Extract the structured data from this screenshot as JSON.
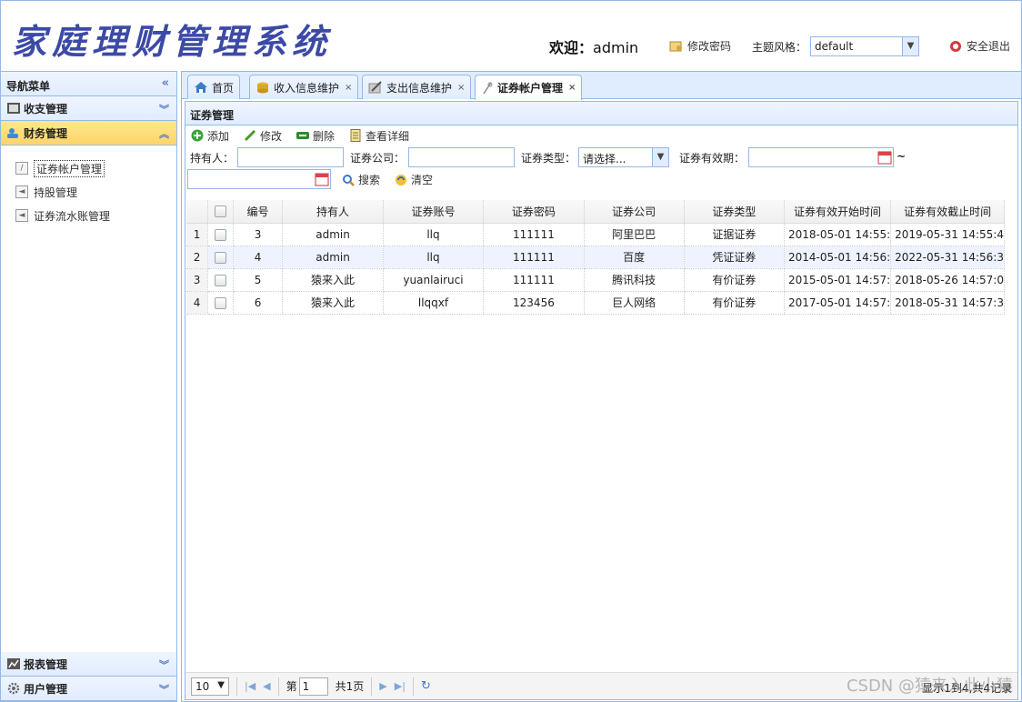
{
  "header": {
    "logo": "家庭理财管理系统",
    "welcome_prefix": "欢迎：",
    "username": "admin",
    "change_password": "修改密码",
    "theme_label": "主题风格：",
    "theme_value": "default",
    "logout": "安全退出"
  },
  "sidebar": {
    "title": "导航菜单",
    "groups": [
      {
        "label": "收支管理"
      },
      {
        "label": "财务管理"
      },
      {
        "label": "报表管理"
      },
      {
        "label": "用户管理"
      }
    ],
    "items": [
      {
        "label": "证券帐户管理"
      },
      {
        "label": "持股管理"
      },
      {
        "label": "证券流水账管理"
      }
    ]
  },
  "tabs": [
    {
      "label": "首页"
    },
    {
      "label": "收入信息维护"
    },
    {
      "label": "支出信息维护"
    },
    {
      "label": "证券帐户管理"
    }
  ],
  "panel": {
    "title": "证券管理",
    "toolbar": {
      "add": "添加",
      "edit": "修改",
      "delete": "删除",
      "detail": "查看详细"
    },
    "search": {
      "holder_label": "持有人：",
      "company_label": "证券公司：",
      "type_label": "证券类型：",
      "type_value": "请选择...",
      "validity_label": "证券有效期：",
      "tilde": "~",
      "search_btn": "搜索",
      "clear_btn": "清空"
    }
  },
  "grid": {
    "columns": [
      "编号",
      "持有人",
      "证券账号",
      "证券密码",
      "证券公司",
      "证券类型",
      "证券有效开始时间",
      "证券有效截止时间"
    ],
    "rows": [
      {
        "rn": "1",
        "id": "3",
        "holder": "admin",
        "account": "llq",
        "password": "111111",
        "company": "阿里巴巴",
        "type": "证据证券",
        "start": "2018-05-01 14:55:",
        "end": "2019-05-31 14:55:4"
      },
      {
        "rn": "2",
        "id": "4",
        "holder": "admin",
        "account": "llq",
        "password": "111111",
        "company": "百度",
        "type": "凭证证券",
        "start": "2014-05-01 14:56:",
        "end": "2022-05-31 14:56:3"
      },
      {
        "rn": "3",
        "id": "5",
        "holder": "猿来入此",
        "account": "yuanlairuci",
        "password": "111111",
        "company": "腾讯科技",
        "type": "有价证券",
        "start": "2015-05-01 14:57:",
        "end": "2018-05-26 14:57:0"
      },
      {
        "rn": "4",
        "id": "6",
        "holder": "猿来入此",
        "account": "llqqxf",
        "password": "123456",
        "company": "巨人网络",
        "type": "有价证券",
        "start": "2017-05-01 14:57:",
        "end": "2018-05-31 14:57:3"
      }
    ]
  },
  "pager": {
    "page_size": "10",
    "page_prefix": "第",
    "page_value": "1",
    "page_suffix": "共1页",
    "info": "显示1到4,共4记录"
  },
  "watermark": "CSDN @猿来入此小猿"
}
